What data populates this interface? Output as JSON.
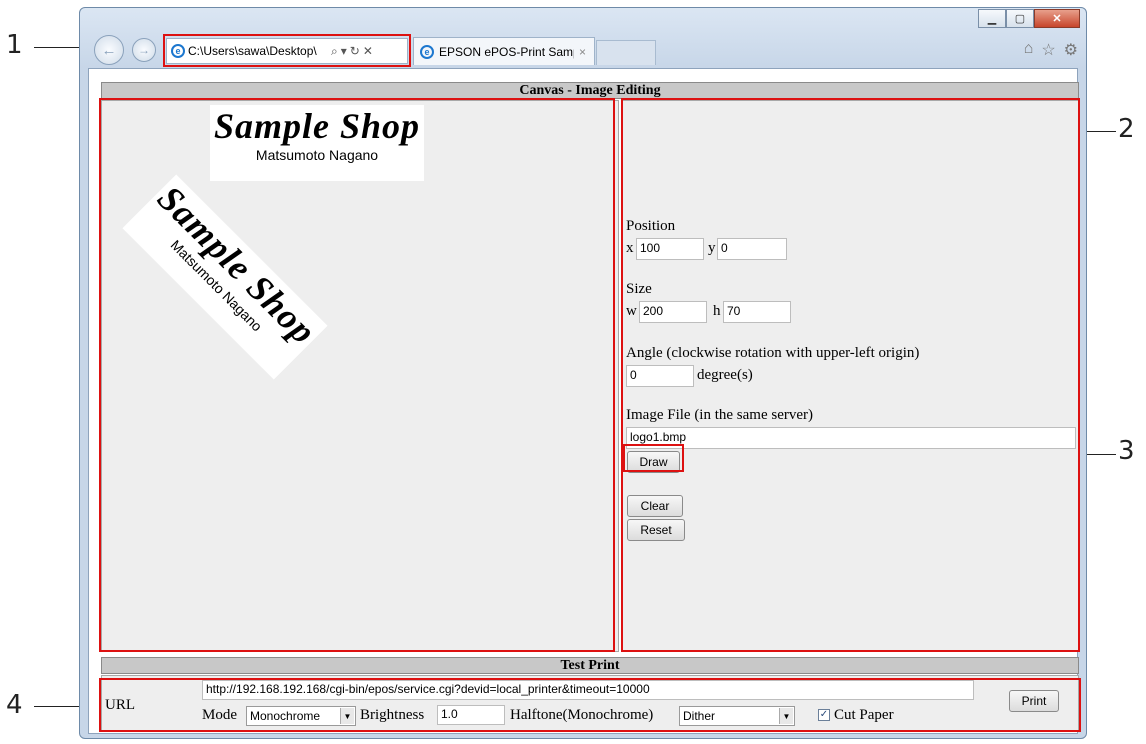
{
  "callouts": [
    "1",
    "2",
    "3",
    "4"
  ],
  "browser": {
    "address": "C:\\Users\\sawa\\Desktop\\",
    "tab_title": "EPSON ePOS-Print Sample ...",
    "tab_close": "×"
  },
  "canvas_section": {
    "header": "Canvas - Image Editing",
    "logo_title": "Sample Shop",
    "logo_subtitle": "Matsumoto Nagano",
    "rotated_logo_angle_deg": 45
  },
  "form": {
    "position_label": "Position",
    "x_label": "x",
    "x_value": "100",
    "y_label": "y",
    "y_value": "0",
    "size_label": "Size",
    "w_label": "w",
    "w_value": "200",
    "h_label": "h",
    "h_value": "70",
    "angle_label": "Angle (clockwise rotation with upper-left origin)",
    "angle_value": "0",
    "angle_unit": "degree(s)",
    "image_file_label": "Image File (in the same server)",
    "image_file_value": "logo1.bmp",
    "draw_button": "Draw",
    "clear_button": "Clear",
    "reset_button": "Reset"
  },
  "test_print": {
    "header": "Test Print",
    "url_label": "URL",
    "url_value": "http://192.168.192.168/cgi-bin/epos/service.cgi?devid=local_printer&timeout=10000",
    "mode_label": "Mode",
    "mode_value": "Monochrome",
    "brightness_label": "Brightness",
    "brightness_value": "1.0",
    "halftone_label": "Halftone(Monochrome)",
    "halftone_value": "Dither",
    "cut_paper_label": "Cut Paper",
    "cut_paper_checked": true,
    "print_button": "Print"
  }
}
